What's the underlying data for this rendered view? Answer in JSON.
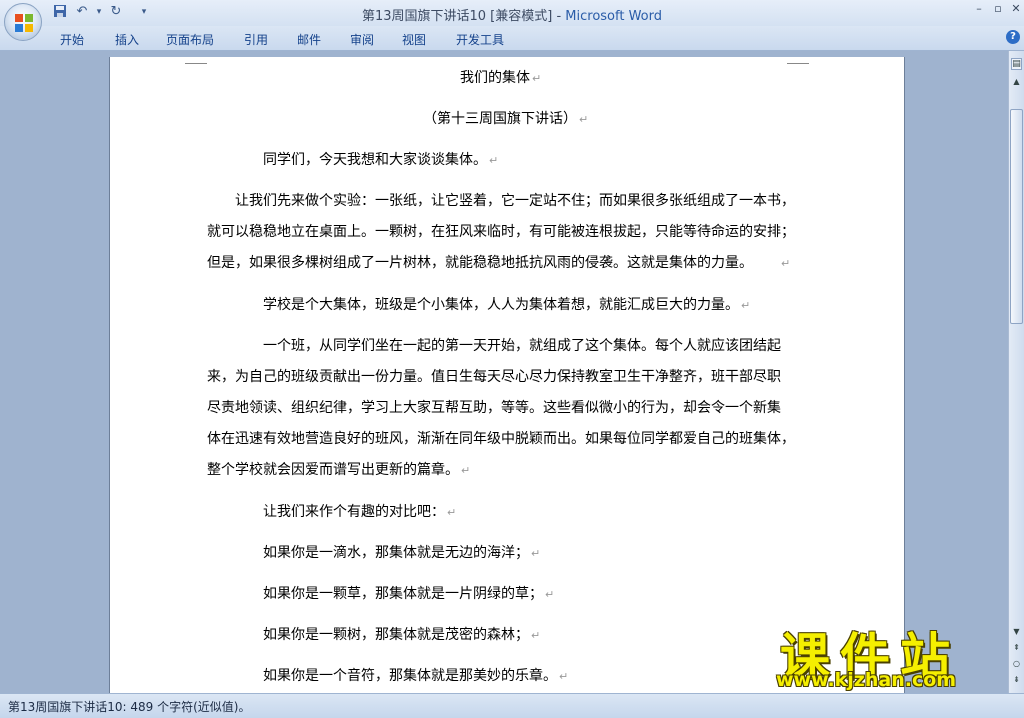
{
  "window": {
    "title_doc": "第13周国旗下讲话10 [兼容模式] - ",
    "title_app": "Microsoft Word"
  },
  "ribbon": {
    "tabs": [
      "开始",
      "插入",
      "页面布局",
      "引用",
      "邮件",
      "审阅",
      "视图",
      "开发工具"
    ]
  },
  "document": {
    "paragraphs": [
      "我们的集体",
      "（第十三周国旗下讲话）",
      "同学们，今天我想和大家谈谈集体。",
      "让我们先来做个实验：一张纸，让它竖着，它一定站不住；而如果很多张纸组成了一本书，",
      "就可以稳稳地立在桌面上。一颗树，在狂风来临时，有可能被连根拔起，只能等待命运的安排；",
      "但是，如果很多棵树组成了一片树林，就能稳稳地抵抗风雨的侵袭。这就是集体的力量。",
      "学校是个大集体，班级是个小集体，人人为集体着想，就能汇成巨大的力量。",
      "一个班，从同学们坐在一起的第一天开始，就组成了这个集体。每个人就应该团结起",
      "来，为自己的班级贡献出一份力量。值日生每天尽心尽力保持教室卫生干净整齐，班干部尽职",
      "尽责地领读、组织纪律，学习上大家互帮互助，等等。这些看似微小的行为，却会令一个新集",
      "体在迅速有效地营造良好的班风，渐渐在同年级中脱颖而出。如果每位同学都爱自己的班集体，",
      "整个学校就会因爱而谱写出更新的篇章。",
      "让我们来作个有趣的对比吧：",
      "如果你是一滴水，那集体就是无边的海洋；",
      "如果你是一颗草，那集体就是一片阴绿的草；",
      "如果你是一颗树，那集体就是茂密的森林；",
      "如果你是一个音符，那集体就是那美妙的乐章。"
    ],
    "paragraph_mark": "↵"
  },
  "statusbar": {
    "text": "第13周国旗下讲话10: 489 个字符(近似值)。"
  },
  "watermark": {
    "big": "课件站",
    "url": "www.kjzhan.com"
  }
}
